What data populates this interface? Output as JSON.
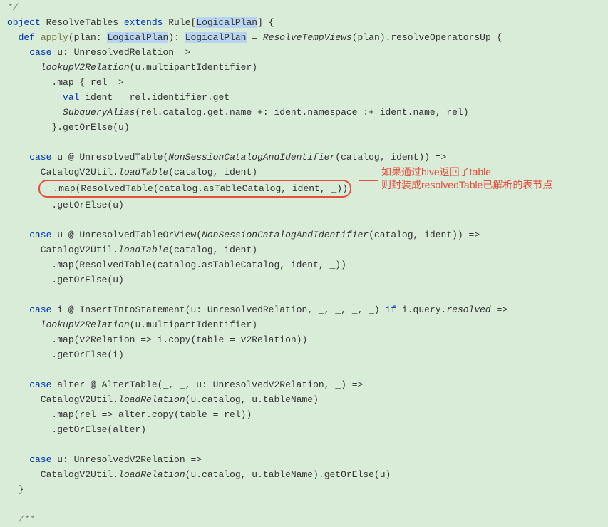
{
  "code": {
    "l1": "*/",
    "l2_object": "object",
    "l2_class": " ResolveTables ",
    "l2_extends": "extends",
    "l2_rule": " Rule[",
    "l2_lp": "LogicalPlan",
    "l2_end": "] {",
    "l3_def": "  def",
    "l3_apply": " apply",
    "l3_sig1": "(plan: ",
    "l3_lp1": "LogicalPlan",
    "l3_sig2": "): ",
    "l3_lp2": "LogicalPlan",
    "l3_sig3": " = ",
    "l3_rtv": "ResolveTempViews",
    "l3_sig4": "(plan).resolveOperatorsUp {",
    "l4_case": "    case",
    "l4_rest": " u: UnresolvedRelation =>",
    "l5": "      lookupV2Relation",
    "l5_rest": "(u.multipartIdentifier)",
    "l6": "        .map { rel =>",
    "l7_val": "          val",
    "l7_rest": " ident = rel.identifier.get",
    "l8_sa": "          SubqueryAlias",
    "l8_rest": "(rel.catalog.get.name +: ident.namespace :+ ident.name, rel)",
    "l9": "        }.getOrElse(u)",
    "l11_case": "    case",
    "l11_rest1": " u @ UnresolvedTable(",
    "l11_nsc": "NonSessionCatalogAndIdentifier",
    "l11_rest2": "(catalog, ident)) =>",
    "l12_cv2": "      CatalogV2Util.",
    "l12_lt": "loadTable",
    "l12_rest": "(catalog, ident)",
    "l13": "        .map(ResolvedTable(catalog.asTableCatalog, ident, _))",
    "l14": "        .getOrElse(u)",
    "l16_case": "    case",
    "l16_rest1": " u @ UnresolvedTableOrView(",
    "l16_nsc": "NonSessionCatalogAndIdentifier",
    "l16_rest2": "(catalog, ident)) =>",
    "l17_cv2": "      CatalogV2Util.",
    "l17_lt": "loadTable",
    "l17_rest": "(catalog, ident)",
    "l18": "        .map(ResolvedTable(catalog.asTableCatalog, ident, _))",
    "l19": "        .getOrElse(u)",
    "l21_case": "    case",
    "l21_rest1": " i @ InsertIntoStatement(u: UnresolvedRelation, _, _, _, _) ",
    "l21_if": "if",
    "l21_rest2": " i.query.",
    "l21_resolved": "resolved",
    "l21_rest3": " =>",
    "l22": "      lookupV2Relation",
    "l22_rest": "(u.multipartIdentifier)",
    "l23": "        .map(v2Relation => i.copy(table = v2Relation))",
    "l24": "        .getOrElse(i)",
    "l26_case": "    case",
    "l26_rest": " alter @ AlterTable(_, _, u: UnresolvedV2Relation, _) =>",
    "l27_cv2": "      CatalogV2Util.",
    "l27_lr": "loadRelation",
    "l27_rest": "(u.catalog, u.tableName)",
    "l28": "        .map(rel => alter.copy(table = rel))",
    "l29": "        .getOrElse(alter)",
    "l31_case": "    case",
    "l31_rest": " u: UnresolvedV2Relation =>",
    "l32_cv2": "      CatalogV2Util.",
    "l32_lr": "loadRelation",
    "l32_rest": "(u.catalog, u.tableName).getOrElse(u)",
    "l33": "  }",
    "l35": "  /**"
  },
  "annotation": {
    "line1": "如果通过hive返回了table",
    "line2": "则封装成resolvedTable已解析的表节点"
  }
}
